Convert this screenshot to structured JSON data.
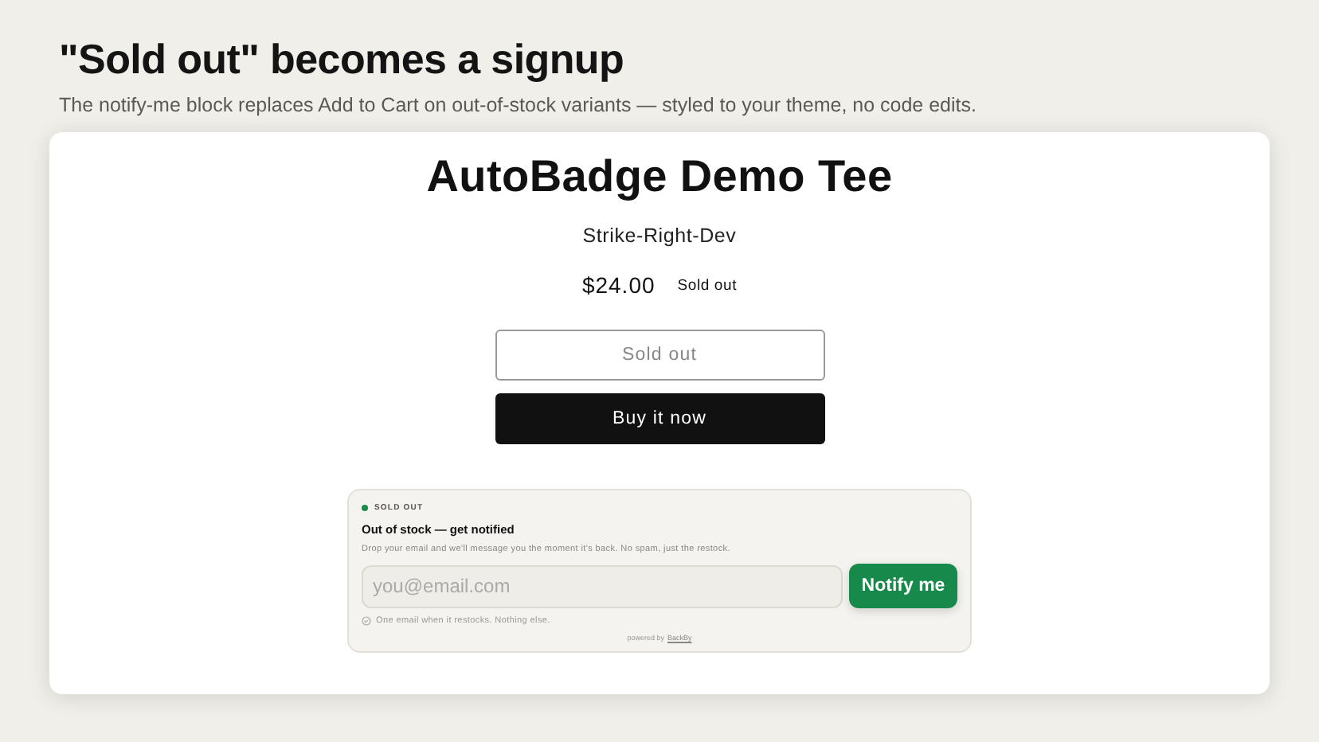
{
  "header": {
    "title": "\"Sold out\" becomes a signup",
    "subtitle": "The notify-me block replaces Add to Cart on out-of-stock variants — styled to your theme, no code edits."
  },
  "product": {
    "title": "AutoBadge Demo Tee",
    "vendor": "Strike-Right-Dev",
    "price": "$24.00",
    "badge": "Sold out",
    "buttons": [
      {
        "kind": "outline",
        "label": "Sold out",
        "disabled": true
      },
      {
        "kind": "solid",
        "label": "Buy it now",
        "disabled": false
      }
    ]
  },
  "notify": {
    "status": {
      "label": "SOLD OUT",
      "color": "#1e8a4a"
    },
    "heading": "Out of stock — get notified",
    "description": "Drop your email and we'll message you the moment it's back. No spam, just the restock.",
    "email": {
      "placeholder": "you@email.com"
    },
    "button": "Notify me",
    "note": "One email when it restocks. Nothing else.",
    "powered_by": "powered by",
    "brand": "BackBy"
  }
}
